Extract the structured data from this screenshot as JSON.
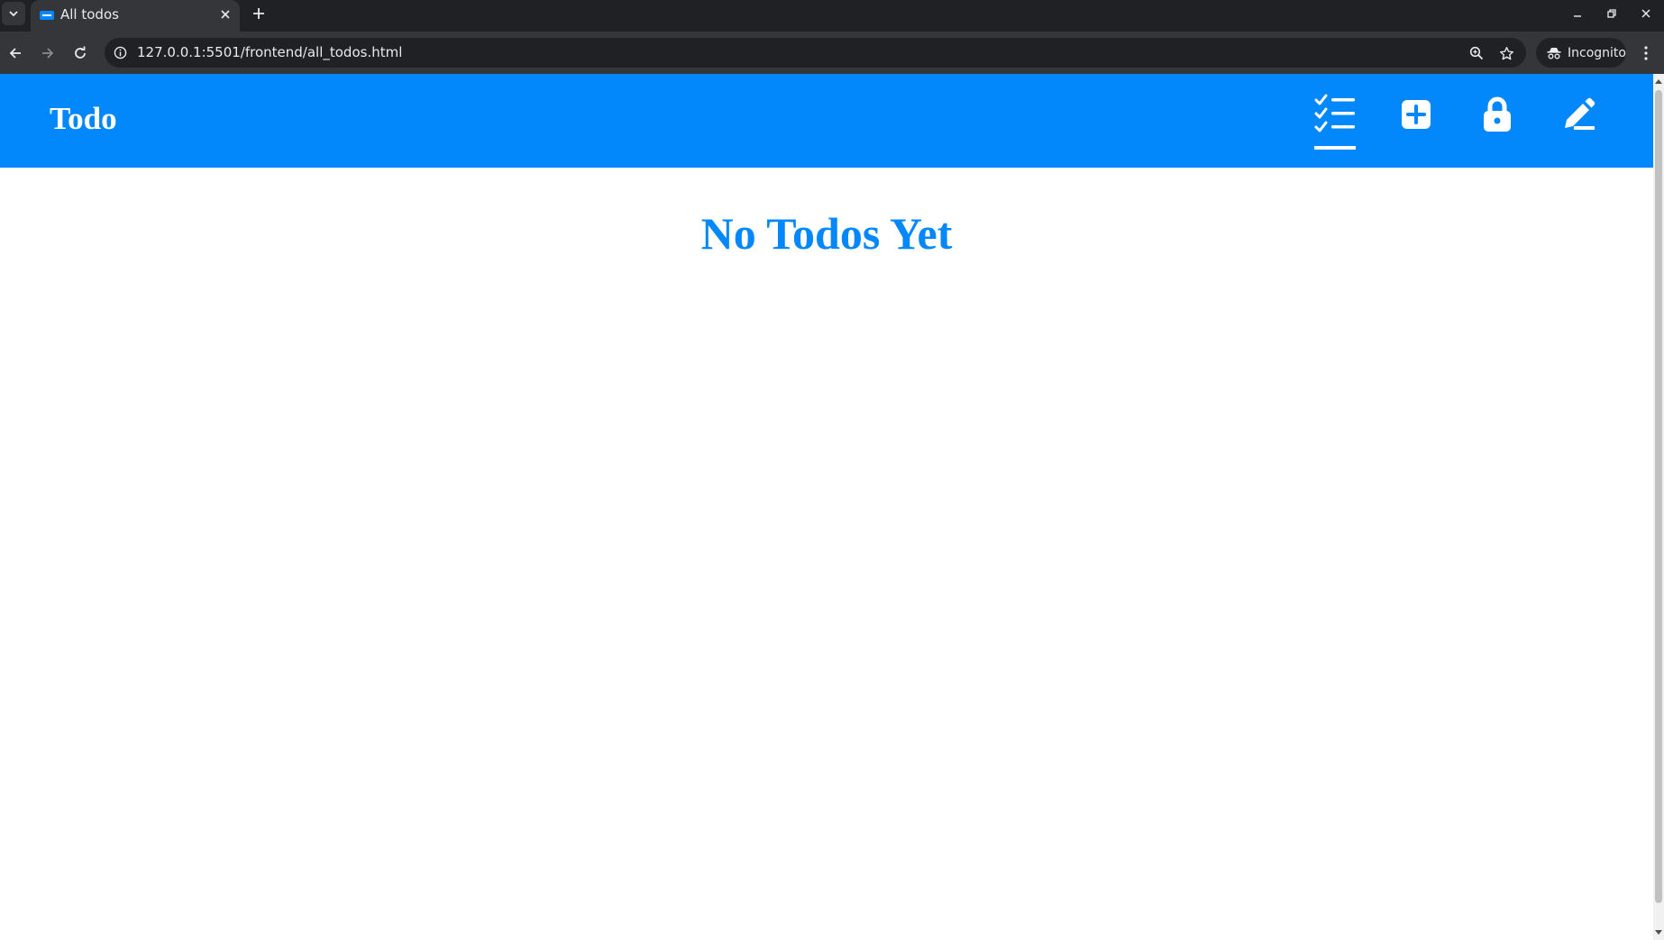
{
  "browser": {
    "tab": {
      "title": "All todos",
      "favicon": "todo-favicon"
    },
    "url": "127.0.0.1:5501/frontend/all_todos.html",
    "incognito_label": "Incognito"
  },
  "app": {
    "brand": "Todo",
    "accent_color": "#0388fc",
    "nav": [
      {
        "name": "all-todos",
        "icon": "checklist-icon",
        "active": true
      },
      {
        "name": "add-todo",
        "icon": "plus-square-icon",
        "active": false
      },
      {
        "name": "lock",
        "icon": "lock-icon",
        "active": false
      },
      {
        "name": "edit",
        "icon": "pencil-icon",
        "active": false
      }
    ]
  },
  "main": {
    "empty_message": "No Todos Yet"
  }
}
